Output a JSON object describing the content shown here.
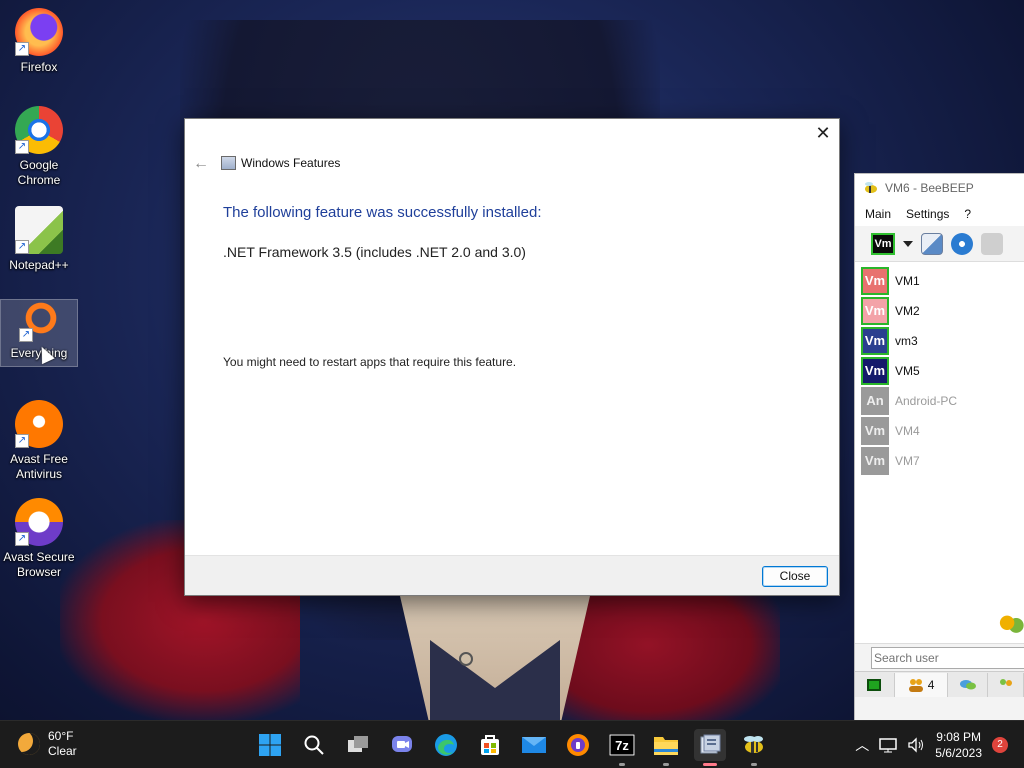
{
  "desktop": {
    "icons": [
      {
        "label": "Firefox",
        "icon": "firefox-icon",
        "color": "#ff7139"
      },
      {
        "label": "Google Chrome",
        "icon": "chrome-icon",
        "color": "#1a73e8"
      },
      {
        "label": "Notepad++",
        "icon": "notepadpp-icon",
        "color": "#8bc34a"
      },
      {
        "label": "Everything",
        "icon": "everything-search-icon",
        "color": "#ff7a1a"
      },
      {
        "label": "Avast Free Antivirus",
        "icon": "avast-icon",
        "color": "#ff7800"
      },
      {
        "label": "Avast Secure Browser",
        "icon": "avast-secure-browser-icon",
        "color": "#6e3cc8"
      }
    ]
  },
  "dialog": {
    "title": "Windows Features",
    "heading": "The following feature was successfully installed:",
    "feature": ".NET Framework 3.5 (includes .NET 2.0 and 3.0)",
    "note": "You might need to restart apps that require this feature.",
    "close_button": "Close",
    "close_glyph": "✕",
    "back_glyph": "←"
  },
  "beebeep": {
    "title": "VM6 - BeeBEEP",
    "menu": [
      "Main",
      "Settings",
      "?"
    ],
    "toolbar_vm": "Vm",
    "users": [
      {
        "avatar": "Vm",
        "name": "VM1",
        "online": true,
        "color": "#e8726f"
      },
      {
        "avatar": "Vm",
        "name": "VM2",
        "online": true,
        "color": "#f3a3a8"
      },
      {
        "avatar": "Vm",
        "name": "vm3",
        "online": true,
        "color": "#2a3f8f"
      },
      {
        "avatar": "Vm",
        "name": "VM5",
        "online": true,
        "color": "#141a6b"
      },
      {
        "avatar": "An",
        "name": "Android-PC",
        "online": false,
        "color": "#9a9a9a"
      },
      {
        "avatar": "Vm",
        "name": "VM4",
        "online": false,
        "color": "#9a9a9a"
      },
      {
        "avatar": "Vm",
        "name": "VM7",
        "online": false,
        "color": "#9a9a9a"
      }
    ],
    "search_placeholder": "Search user",
    "users_count": "4"
  },
  "taskbar": {
    "weather_temp": "60°F",
    "weather_desc": "Clear",
    "apps": [
      "start-windows-icon",
      "search-icon",
      "task-view-icon",
      "teams-chat-icon",
      "edge-icon",
      "microsoft-store-icon",
      "mail-icon",
      "avast-secure-browser-icon",
      "7zip-icon",
      "file-explorer-icon",
      "windows-features-icon",
      "beebeep-icon"
    ],
    "time": "9:08 PM",
    "date": "5/6/2023",
    "notifications": "2"
  }
}
